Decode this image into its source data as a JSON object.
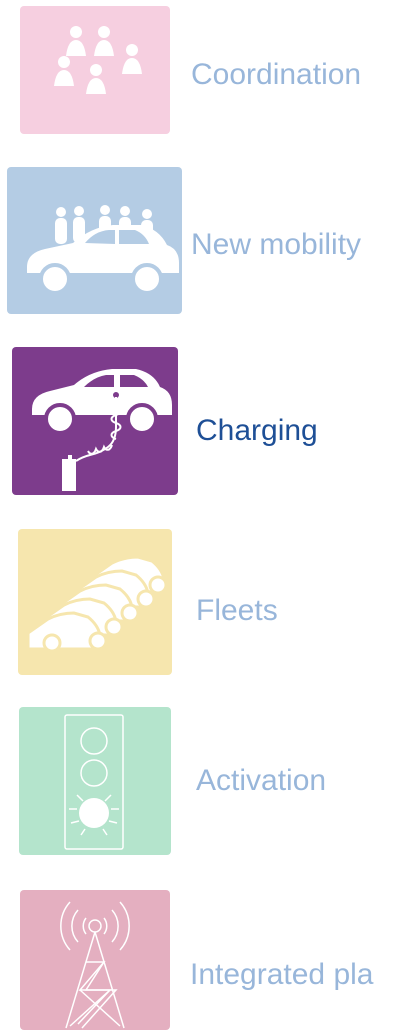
{
  "menu": {
    "items": [
      {
        "label": "Coordination",
        "icon": "people-group-icon",
        "tile_color": "#f6cfe0",
        "active": false
      },
      {
        "label": "New mobility",
        "icon": "car-with-people-icon",
        "tile_color": "#b4cce4",
        "active": false
      },
      {
        "label": "Charging",
        "icon": "car-charging-icon",
        "tile_color": "#7d3c8c",
        "active": true
      },
      {
        "label": "Fleets",
        "icon": "car-fleet-icon",
        "tile_color": "#f6e6ae",
        "active": false
      },
      {
        "label": "Activation",
        "icon": "traffic-light-icon",
        "tile_color": "#b4e4cc",
        "active": false
      },
      {
        "label": "Integrated pla",
        "icon": "radio-tower-icon",
        "tile_color": "#e4afc0",
        "active": false
      }
    ]
  },
  "colors": {
    "inactive_text": "#98b6da",
    "active_text": "#1e4f96",
    "icon_fill": "#ffffff"
  }
}
